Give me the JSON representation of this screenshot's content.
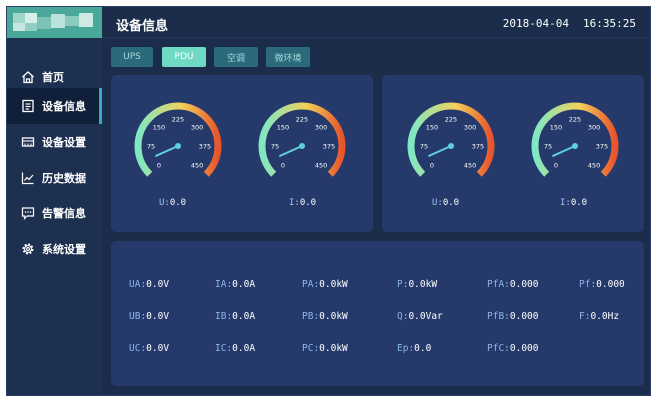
{
  "header": {
    "title": "设备信息",
    "date": "2018-04-04",
    "time": "16:35:25"
  },
  "sidebar": {
    "items": [
      {
        "label": "首页",
        "icon": "home-icon",
        "active": false
      },
      {
        "label": "设备信息",
        "icon": "document-list-icon",
        "active": true
      },
      {
        "label": "设备设置",
        "icon": "device-icon",
        "active": false
      },
      {
        "label": "历史数据",
        "icon": "trend-chart-icon",
        "active": false
      },
      {
        "label": "告警信息",
        "icon": "message-icon",
        "active": false
      },
      {
        "label": "系统设置",
        "icon": "gear-icon",
        "active": false
      }
    ]
  },
  "tabs": [
    {
      "label": "UPS",
      "active": false
    },
    {
      "label": "PDU",
      "active": true
    },
    {
      "label": "空调",
      "active": false
    },
    {
      "label": "微环境",
      "active": false
    }
  ],
  "gauges": [
    {
      "label": "U",
      "value": "0.0",
      "ticks": [
        "0",
        "75",
        "150",
        "225",
        "300",
        "375",
        "450"
      ],
      "needle_value": 35
    },
    {
      "label": "I",
      "value": "0.0",
      "ticks": [
        "0",
        "75",
        "150",
        "225",
        "300",
        "375",
        "450"
      ],
      "needle_value": 35
    },
    {
      "label": "U",
      "value": "0.0",
      "ticks": [
        "0",
        "75",
        "150",
        "225",
        "300",
        "375",
        "450"
      ],
      "needle_value": 35
    },
    {
      "label": "I",
      "value": "0.0",
      "ticks": [
        "0",
        "75",
        "150",
        "225",
        "300",
        "375",
        "450"
      ],
      "needle_value": 35
    }
  ],
  "metrics": [
    [
      {
        "label": "UA:",
        "value": "0.0V"
      },
      {
        "label": "IA:",
        "value": "0.0A"
      },
      {
        "label": "PA:",
        "value": "0.0kW"
      },
      {
        "label": "P:",
        "value": "0.0kW"
      },
      {
        "label": "PfA:",
        "value": "0.000"
      },
      {
        "label": "Pf:",
        "value": "0.000"
      }
    ],
    [
      {
        "label": "UB:",
        "value": "0.0V"
      },
      {
        "label": "IB:",
        "value": "0.0A"
      },
      {
        "label": "PB:",
        "value": "0.0kW"
      },
      {
        "label": "Q:",
        "value": "0.0Var"
      },
      {
        "label": "PfB:",
        "value": "0.000"
      },
      {
        "label": "F:",
        "value": "0.0Hz"
      }
    ],
    [
      {
        "label": "UC:",
        "value": "0.0V"
      },
      {
        "label": "IC:",
        "value": "0.0A"
      },
      {
        "label": "PC:",
        "value": "0.0kW"
      },
      {
        "label": "Ep:",
        "value": "0.0"
      },
      {
        "label": "PfC:",
        "value": "0.000"
      }
    ]
  ],
  "colors": {
    "background": "#1b2d4a",
    "sidebar": "#1d3050",
    "panel": "#25396a",
    "accent": "#6fd9c6",
    "gauge_start": "#7ee8c4",
    "gauge_mid": "#f2d15a",
    "gauge_end": "#e8552b",
    "needle": "#5fd0d8"
  }
}
